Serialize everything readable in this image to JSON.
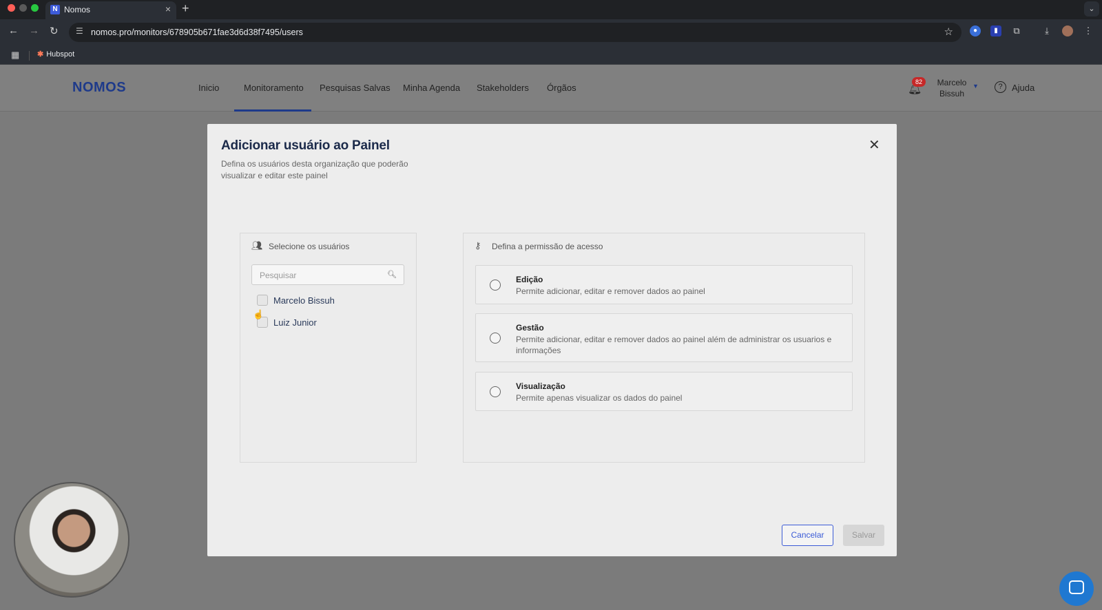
{
  "browser": {
    "tab_title": "Nomos",
    "tab_favicon": "N",
    "tab_close": "×",
    "new_tab": "+",
    "url": "nomos.pro/monitors/678905b671fae3d6d38f7495/users",
    "bookmark": "Hubspot"
  },
  "header": {
    "logo": "NOMOS",
    "nav": [
      "Inicio",
      "Monitoramento",
      "Pesquisas Salvas",
      "Minha Agenda",
      "Stakeholders",
      "Órgãos"
    ],
    "active_nav": "Monitoramento",
    "notification_count": "82",
    "user_name": "Marcelo Bissuh",
    "help_label": "Ajuda"
  },
  "modal": {
    "title": "Adicionar usuário ao Painel",
    "subtitle": "Defina os usuários desta organização que poderão visualizar e editar este painel",
    "users_panel": {
      "heading": "Selecione os usuários",
      "search_placeholder": "Pesquisar",
      "users": [
        "Marcelo Bissuh",
        "Luiz Junior"
      ]
    },
    "permissions_panel": {
      "heading": "Defina a permissão de acesso",
      "options": [
        {
          "title": "Edição",
          "description": "Permite adicionar, editar e remover dados ao painel"
        },
        {
          "title": "Gestão",
          "description": "Permite adicionar, editar e remover dados ao painel além de administrar os usuarios e informações"
        },
        {
          "title": "Visualização",
          "description": "Permite apenas visualizar os dados do painel"
        }
      ]
    },
    "cancel_label": "Cancelar",
    "save_label": "Salvar"
  },
  "colors": {
    "accent": "#3b5bd6",
    "logo": "#1e3a8a",
    "badge": "#c62828"
  }
}
